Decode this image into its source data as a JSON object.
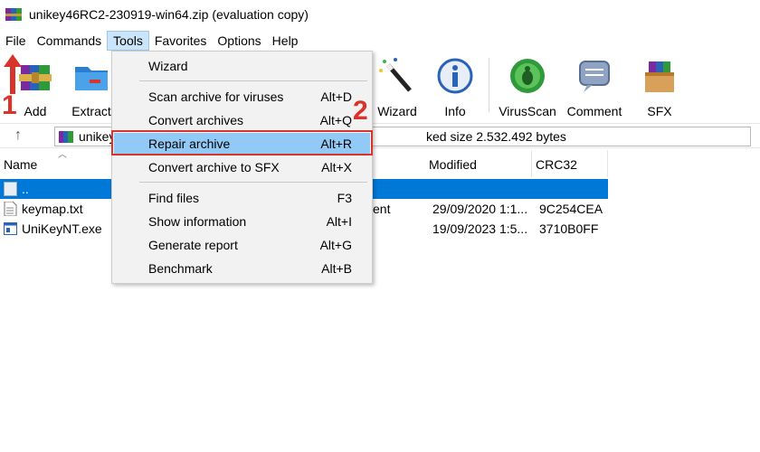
{
  "window": {
    "title": "unikey46RC2-230919-win64.zip (evaluation copy)"
  },
  "menubar": {
    "items": [
      {
        "label": "File",
        "active": false
      },
      {
        "label": "Commands",
        "active": false
      },
      {
        "label": "Tools",
        "active": true
      },
      {
        "label": "Favorites",
        "active": false
      },
      {
        "label": "Options",
        "active": false
      },
      {
        "label": "Help",
        "active": false
      }
    ]
  },
  "toolbar": {
    "add": "Add",
    "extract": "Extract",
    "wizard": "Wizard",
    "info": "Info",
    "virusscan": "VirusScan",
    "comment": "Comment",
    "sfx": "SFX"
  },
  "addressbar": {
    "path": "unikey",
    "summary": "ked size 2.532.492 bytes"
  },
  "filelist": {
    "columns": {
      "name": "Name",
      "modified": "Modified",
      "crc": "CRC32"
    },
    "rows": [
      {
        "name": "..",
        "type": "",
        "modified": "",
        "crc": "",
        "selected": true
      },
      {
        "name": "keymap.txt",
        "type": "ent",
        "modified": "29/09/2020 1:1...",
        "crc": "9C254CEA",
        "selected": false
      },
      {
        "name": "UniKeyNT.exe",
        "type": "",
        "modified": "19/09/2023 1:5...",
        "crc": "3710B0FF",
        "selected": false
      }
    ]
  },
  "tools_menu": {
    "items": [
      {
        "label": "Wizard",
        "shortcut": ""
      },
      {
        "label": "Scan archive for viruses",
        "shortcut": "Alt+D"
      },
      {
        "label": "Convert archives",
        "shortcut": "Alt+Q"
      },
      {
        "label": "Repair archive",
        "shortcut": "Alt+R",
        "highlighted": true
      },
      {
        "label": "Convert archive to SFX",
        "shortcut": "Alt+X"
      },
      {
        "label": "Find files",
        "shortcut": "F3"
      },
      {
        "label": "Show information",
        "shortcut": "Alt+I"
      },
      {
        "label": "Generate report",
        "shortcut": "Alt+G"
      },
      {
        "label": "Benchmark",
        "shortcut": "Alt+B"
      }
    ]
  },
  "annotations": {
    "step1": "1",
    "step2": "2"
  },
  "colors": {
    "selection": "#0078d7",
    "menu_highlight": "#91c9f7",
    "annotation": "#d9342b"
  }
}
